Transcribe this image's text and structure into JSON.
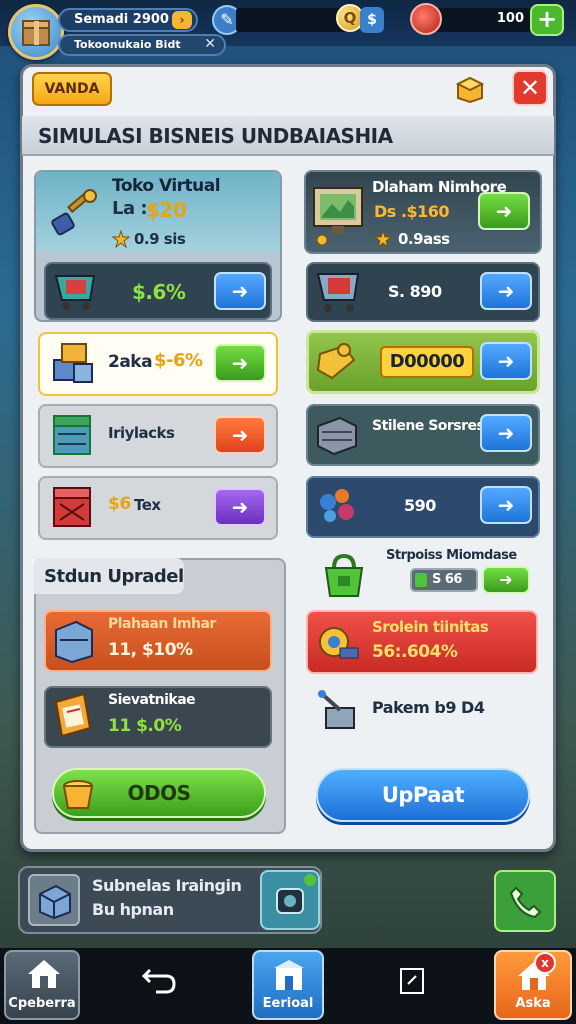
{
  "top": {
    "player_name": "Semadi 2900",
    "player_sub": "Tokoonukaio Bidt",
    "gems": "100",
    "coin_symbol": "Q",
    "coin_plus": "+"
  },
  "panel": {
    "tag_label": "VANDA",
    "title": "SIMULASI BISNEIS UNDBAIASHIA"
  },
  "left_cards": [
    {
      "title": "Toko Virtual",
      "price": "$20",
      "price_prefix": "La :",
      "sub": "0.9 sis"
    },
    {
      "value": "$.6%"
    },
    {
      "label": "2aka",
      "value": "$-6%"
    },
    {
      "label": "Iriylacks"
    },
    {
      "label": "$6",
      "suffix": "Tex"
    }
  ],
  "right_cards": [
    {
      "title": "Dlaham Nimhore",
      "price": "Ds .$160",
      "sub": "0.9ass"
    },
    {
      "value": "S. 890"
    },
    {
      "value": "D00000"
    },
    {
      "label": "Stilene Sorsres"
    },
    {
      "value": "590"
    }
  ],
  "mid_right": {
    "label": "Strpoiss Miomdase",
    "value": "S 66"
  },
  "upgrade": {
    "title": "Stdun Upradel",
    "items": [
      {
        "title": "Plahaan Imhar",
        "value": "11, $10%"
      },
      {
        "title": "Sievatnikae",
        "value": "11 $.0%"
      }
    ],
    "button": "ODOS"
  },
  "right_lower": [
    {
      "title": "Srolein tiinitas",
      "value": "56:.604%"
    },
    {
      "title": "Pakem b9 D4"
    }
  ],
  "update_button": "UpPaat",
  "footer_card": {
    "line1": "Subnelas Iraingin",
    "line2": "Bu hpnan"
  },
  "nav": {
    "home": "Cpeberra",
    "center": "Eerioal",
    "right": "Aska",
    "badge": "x"
  },
  "colors": {
    "accent": "#1f74d8",
    "success": "#3a9b1c",
    "danger": "#e23a2f",
    "warning": "#f5a614"
  }
}
